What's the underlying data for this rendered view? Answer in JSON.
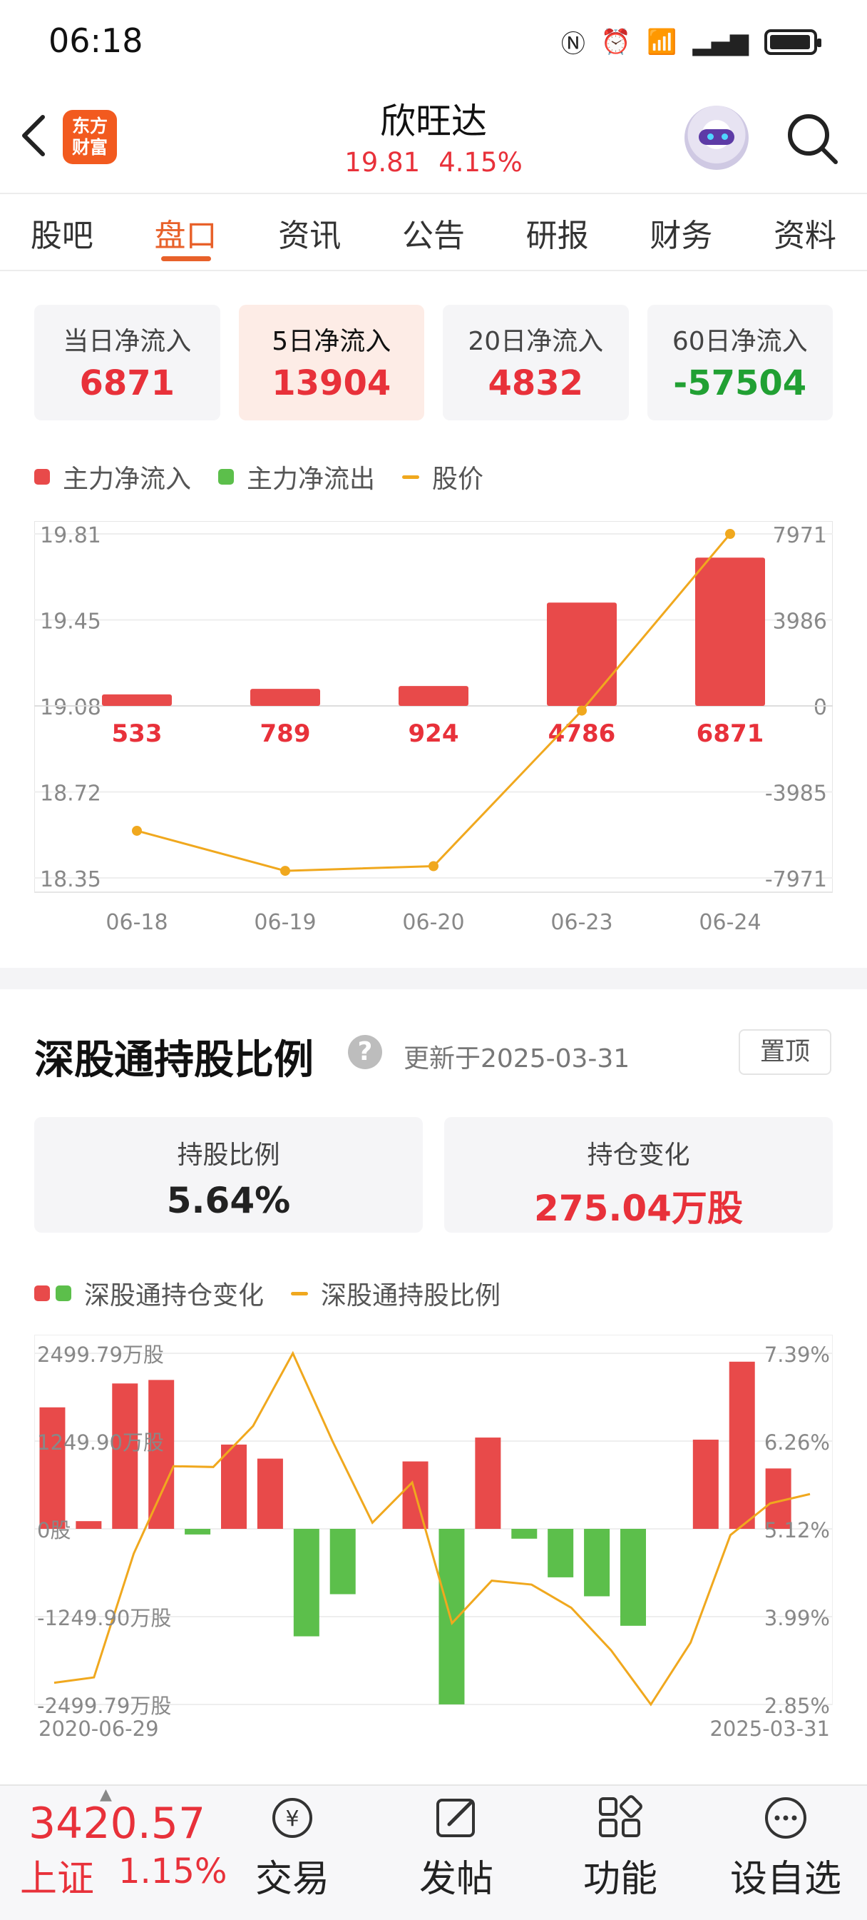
{
  "status_bar": {
    "time": "06:18",
    "icons": [
      "nfc-icon",
      "alarm-icon",
      "wifi-icon",
      "signal-4g-icon",
      "battery-icon"
    ]
  },
  "header": {
    "logo_text_line1": "东方",
    "logo_text_line2": "财富",
    "stock_name": "欣旺达",
    "price": "19.81",
    "change_pct": "4.15%",
    "accent_color": "#e8313a"
  },
  "tabs": [
    {
      "label": "股吧",
      "active": false
    },
    {
      "label": "盘口",
      "active": true
    },
    {
      "label": "资讯",
      "active": false
    },
    {
      "label": "公告",
      "active": false
    },
    {
      "label": "研报",
      "active": false
    },
    {
      "label": "财务",
      "active": false
    },
    {
      "label": "资料",
      "active": false
    }
  ],
  "flow_cards": [
    {
      "label": "当日净流入",
      "value": "6871",
      "color": "#e8313a",
      "active": false
    },
    {
      "label": "5日净流入",
      "value": "13904",
      "color": "#e8313a",
      "active": true
    },
    {
      "label": "20日净流入",
      "value": "4832",
      "color": "#e8313a",
      "active": false
    },
    {
      "label": "60日净流入",
      "value": "-57504",
      "color": "#21a033",
      "active": false
    }
  ],
  "flow_legend": {
    "inflow": "主力净流入",
    "outflow": "主力净流出",
    "price": "股价"
  },
  "hk_section": {
    "title": "深股通持股比例",
    "updated": "更新于2025-03-31",
    "pin_label": "置顶",
    "hold_ratio_label": "持股比例",
    "hold_ratio_value": "5.64%",
    "hold_change_label": "持仓变化",
    "hold_change_value": "275.04万股",
    "legend_change": "深股通持仓变化",
    "legend_ratio": "深股通持股比例"
  },
  "chart_data": [
    {
      "type": "bar",
      "categories": [
        "06-18",
        "06-19",
        "06-20",
        "06-23",
        "06-24"
      ],
      "series": [
        {
          "name": "主力净流入",
          "values": [
            533,
            789,
            924,
            4786,
            6871
          ],
          "color": "#e84a4a"
        },
        {
          "name": "股价",
          "type": "line",
          "values": [
            18.55,
            18.38,
            18.4,
            19.06,
            19.81
          ],
          "color": "#f0a81e"
        }
      ],
      "y_left_ticks": [
        "19.81",
        "19.45",
        "19.08",
        "18.72",
        "18.35"
      ],
      "y_right_ticks": [
        "7971",
        "3986",
        "0",
        "-3985",
        "-7971"
      ],
      "y_left_range": [
        18.35,
        19.81
      ],
      "y_right_range": [
        -7971,
        7971
      ],
      "grid": true
    },
    {
      "type": "bar",
      "x_range_labels": [
        "2020-06-29",
        "2025-03-31"
      ],
      "series": [
        {
          "name": "深股通持仓变化",
          "values": [
            1730,
            110,
            2070,
            2120,
            -80,
            1200,
            1000,
            -1530,
            -930,
            0,
            960,
            -2499,
            1300,
            -140,
            -690,
            -960,
            -1380,
            0,
            1270,
            2380,
            860,
            0
          ],
          "up_color": "#e84a4a",
          "down_color": "#5cbf4b"
        },
        {
          "name": "深股通持股比例",
          "type": "line",
          "values": [
            3.13,
            3.2,
            4.8,
            5.93,
            5.92,
            6.45,
            7.39,
            6.25,
            5.2,
            5.72,
            3.9,
            4.45,
            4.4,
            4.1,
            3.55,
            2.85,
            3.65,
            5.04,
            5.45,
            5.57
          ],
          "color": "#f0a81e"
        }
      ],
      "y_left_ticks": [
        "2499.79万股",
        "1249.90万股",
        "0股",
        "-1249.90万股",
        "-2499.79万股"
      ],
      "y_right_ticks": [
        "7.39%",
        "6.26%",
        "5.12%",
        "3.99%",
        "2.85%"
      ],
      "y_left_range": [
        -2499.79,
        2499.79
      ],
      "y_right_range": [
        2.85,
        7.39
      ],
      "grid": true
    }
  ],
  "bottom_bar": {
    "index_value": "3420.57",
    "index_name": "上证",
    "index_change": "1.15%",
    "nav": [
      {
        "label": "交易",
        "icon": "trade-icon"
      },
      {
        "label": "发帖",
        "icon": "post-icon"
      },
      {
        "label": "功能",
        "icon": "grid-icon"
      },
      {
        "label": "设自选",
        "icon": "more-icon"
      }
    ]
  }
}
